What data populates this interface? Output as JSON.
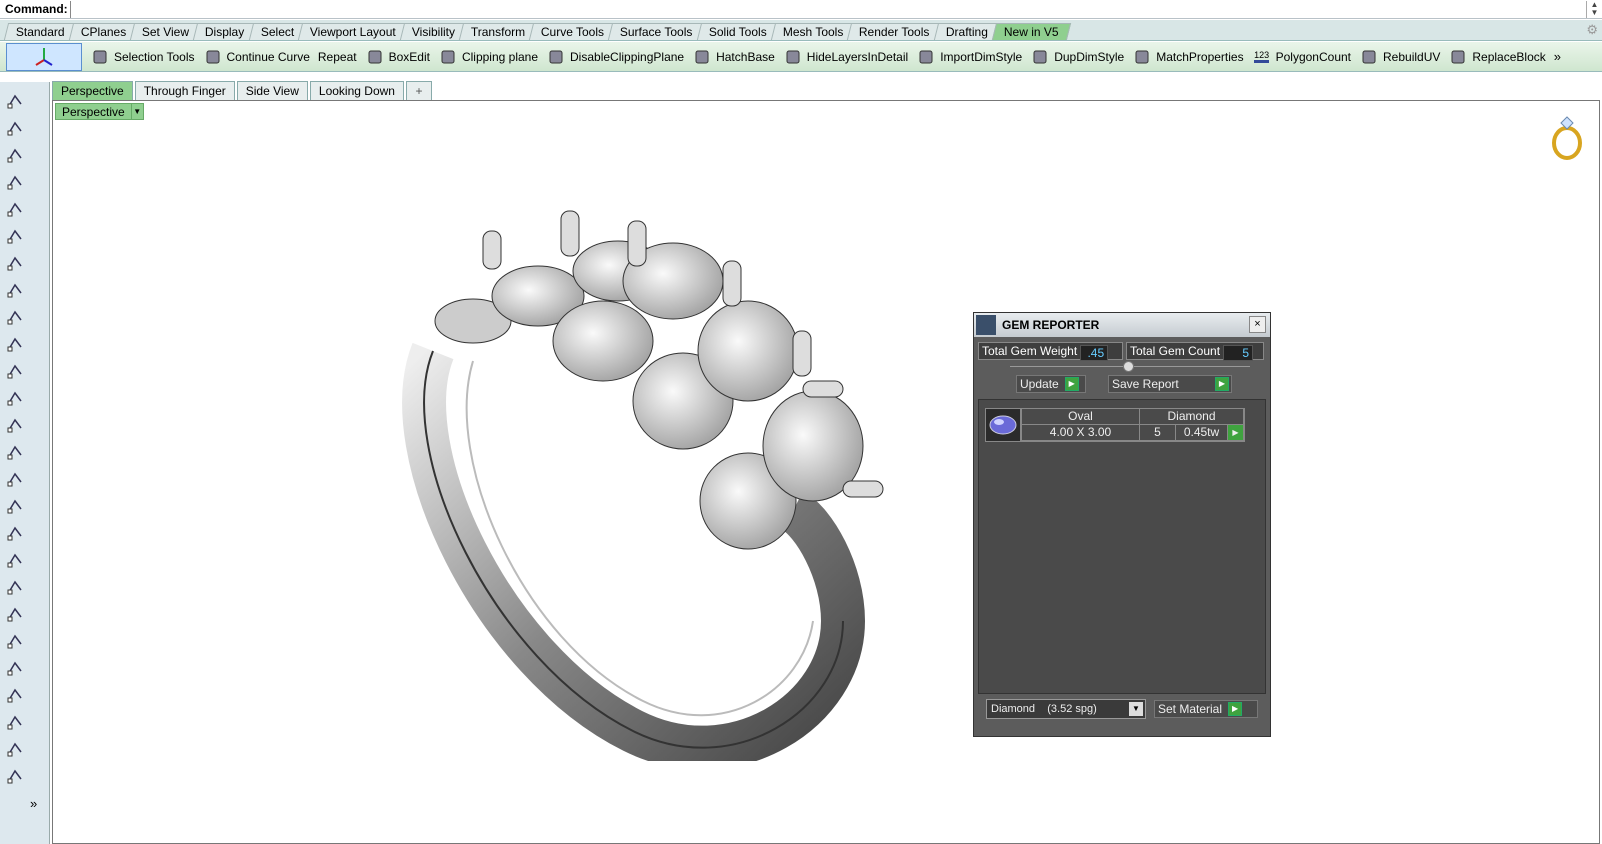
{
  "command": {
    "label": "Command:"
  },
  "tabs": [
    "Standard",
    "CPlanes",
    "Set View",
    "Display",
    "Select",
    "Viewport Layout",
    "Visibility",
    "Transform",
    "Curve Tools",
    "Surface Tools",
    "Solid Tools",
    "Mesh Tools",
    "Render Tools",
    "Drafting",
    "New in V5"
  ],
  "active_tab": "New in V5",
  "toolbar": {
    "items": [
      {
        "label": "Selection Tools",
        "icon": "selection-tools-icon"
      },
      {
        "label": "Continue Curve",
        "icon": "continue-curve-icon"
      },
      {
        "label": "Repeat",
        "icon": ""
      },
      {
        "label": "BoxEdit",
        "icon": "boxedit-icon"
      },
      {
        "label": "Clipping plane",
        "icon": "clipping-plane-icon"
      },
      {
        "label": "DisableClippingPlane",
        "icon": "disable-clipping-plane-icon"
      },
      {
        "label": "HatchBase",
        "icon": "hatchbase-icon"
      },
      {
        "label": "HideLayersInDetail",
        "icon": "hide-layers-icon"
      },
      {
        "label": "ImportDimStyle",
        "icon": "import-dimstyle-icon"
      },
      {
        "label": "DupDimStyle",
        "icon": "dup-dimstyle-icon"
      },
      {
        "label": "MatchProperties",
        "icon": "match-properties-icon"
      },
      {
        "label": "PolygonCount",
        "icon": "polygon-count-icon"
      },
      {
        "label": "RebuildUV",
        "icon": "rebuild-uv-icon"
      },
      {
        "label": "ReplaceBlock",
        "icon": "replace-block-icon"
      }
    ],
    "more": "»"
  },
  "polygon_icon_text": "123",
  "viewport_tabs": [
    "Perspective",
    "Through Finger",
    "Side View",
    "Looking Down"
  ],
  "viewport_add": "+",
  "viewport": {
    "title": "Perspective"
  },
  "sidebar_more": "»",
  "gem_reporter": {
    "title": "GEM REPORTER",
    "close": "×",
    "total_weight_label": "Total Gem Weight",
    "total_weight": ".45",
    "total_count_label": "Total Gem Count",
    "total_count": "5",
    "update_label": "Update",
    "save_label": "Save Report",
    "entry": {
      "shape": "Oval",
      "material": "Diamond",
      "size": "4.00 X 3.00",
      "count": "5",
      "weight": "0.45tw"
    },
    "material_select": "Diamond    (3.52 spg)",
    "set_material_label": "Set Material"
  },
  "colors": {
    "accent_green": "#8fcf8f",
    "panel_dark": "#5c5c5c",
    "value_blue": "#66ccff"
  }
}
